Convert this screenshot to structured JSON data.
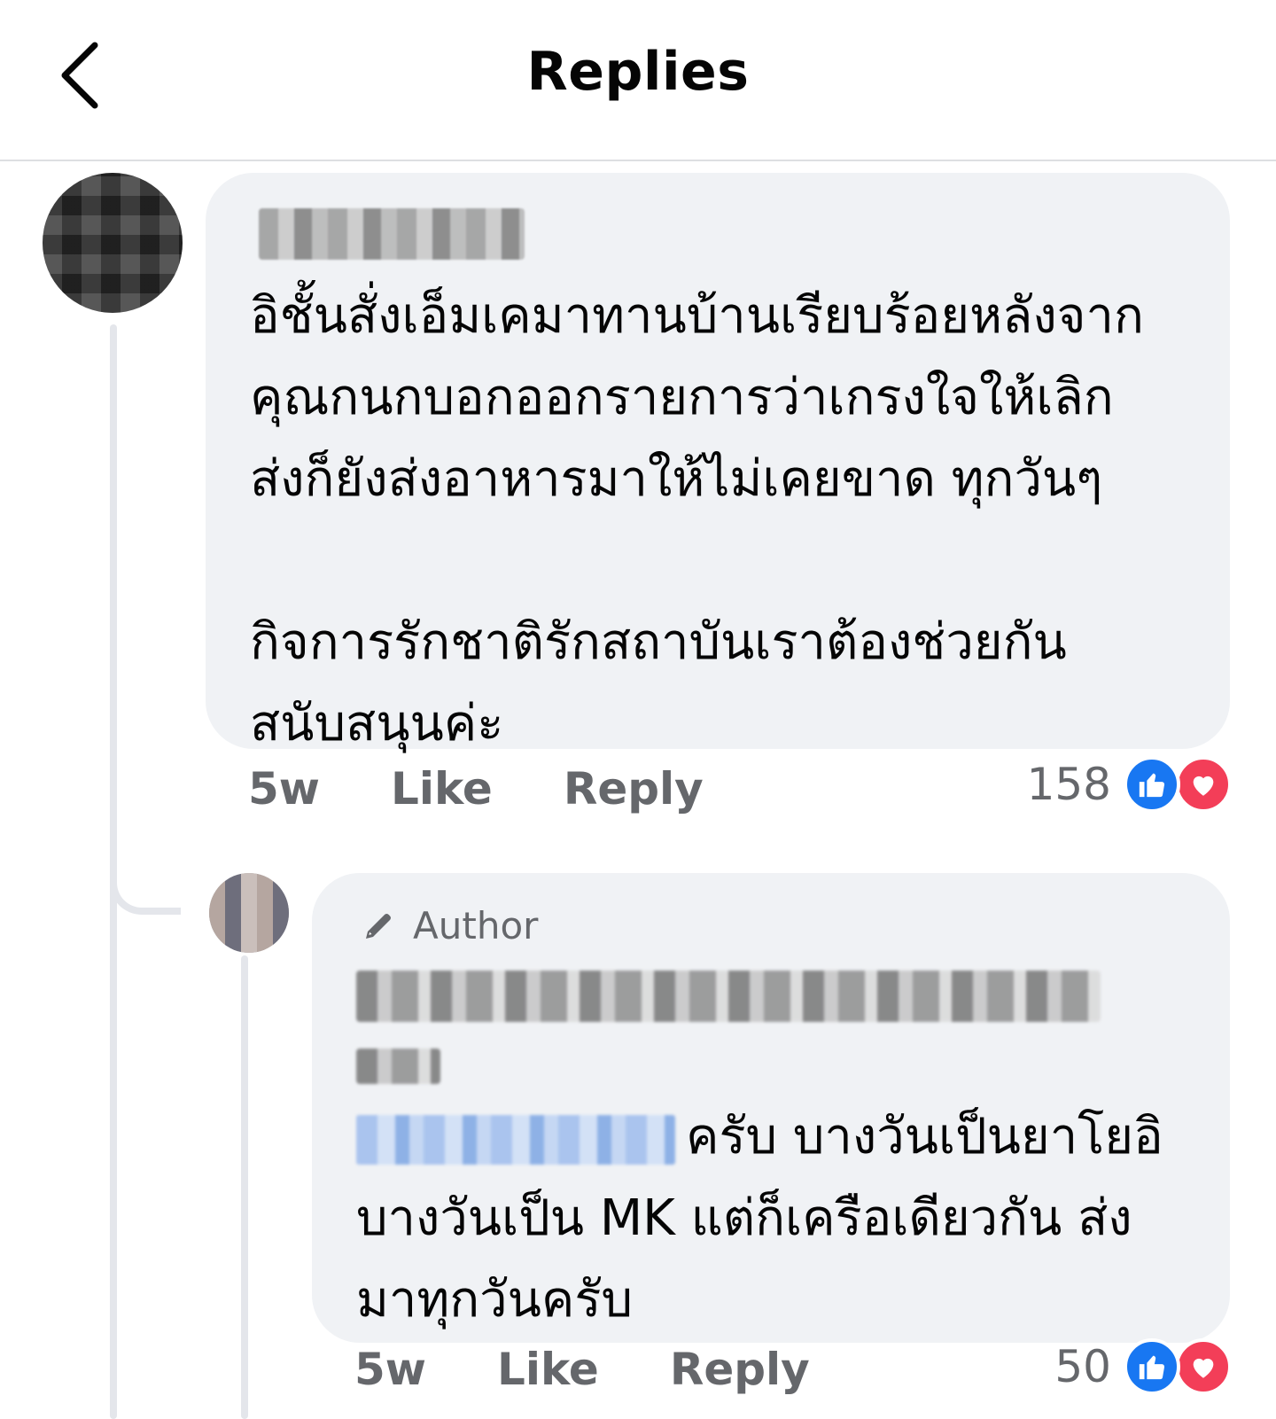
{
  "header": {
    "title": "Replies"
  },
  "comments": [
    {
      "text": "อิชั้นสั่งเอ็มเคมาทานบ้านเรียบร้อยหลังจาก\nคุณกนกบอกออกรายการว่าเกรงใจให้เลิก\nส่งก็ยังส่งอาหารมาให้ไม่เคยขาด ทุกวันๆ\n\nกิจการรักชาติรักสถาบันเราต้องช่วยกัน\nสนับสนุนค่ะ",
      "time": "5w",
      "like_label": "Like",
      "reply_label": "Reply",
      "reaction_count": "158"
    },
    {
      "author_badge": "Author",
      "text": "ครับ บางวันเป็นยาโยอิ\nบางวันเป็น MK แต่ก็เครือเดียวกัน ส่ง\nมาทุกวันครับ",
      "time": "5w",
      "like_label": "Like",
      "reply_label": "Reply",
      "reaction_count": "50"
    }
  ],
  "icons": {
    "back": "chevron-left-icon",
    "like": "thumbs-up-icon",
    "love": "heart-icon",
    "author": "pen-icon"
  },
  "colors": {
    "like_blue": "#1877f2",
    "love_red": "#f33e58",
    "bubble_bg": "#f0f2f5",
    "meta_gray": "#65676b"
  }
}
